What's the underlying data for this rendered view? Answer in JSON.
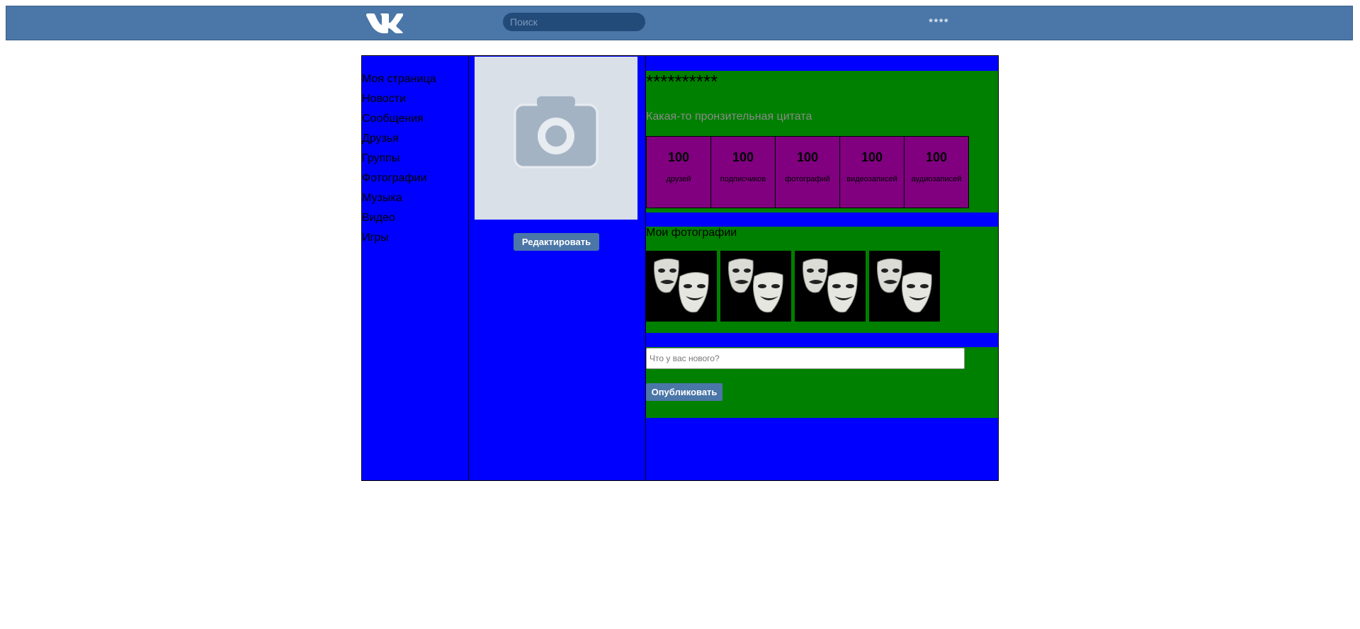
{
  "header": {
    "logo_icon": "vk-logo-icon",
    "search_placeholder": "Поиск",
    "user_name": "****"
  },
  "colors": {
    "header": "#4a76a8",
    "columns": "#0000ff",
    "sections": "#008000",
    "stats": "#800080",
    "buttons": "#4a76a8"
  },
  "sidebar": {
    "items": [
      {
        "label": "Моя страница"
      },
      {
        "label": "Новости"
      },
      {
        "label": "Сообщения"
      },
      {
        "label": "Друзья"
      },
      {
        "label": "Группы"
      },
      {
        "label": "Фотографии"
      },
      {
        "label": "Музыка"
      },
      {
        "label": "Видео"
      },
      {
        "label": "Игры"
      }
    ]
  },
  "profile": {
    "avatar_icon": "camera-placeholder-icon",
    "edit_label": "Редактировать",
    "name": "**********",
    "quote": "Какая-то пронзительная цитата",
    "stats": [
      {
        "value": "100",
        "label": "друзей"
      },
      {
        "value": "100",
        "label": "подписчиков"
      },
      {
        "value": "100",
        "label": "фотографий"
      },
      {
        "value": "100",
        "label": "видеозаписей"
      },
      {
        "value": "100",
        "label": "аудиозаписей"
      }
    ]
  },
  "photos": {
    "title": "Мои фотографии",
    "thumb_icon": "theatre-masks-icon"
  },
  "post": {
    "placeholder": "Что у вас нового?",
    "publish_label": "Опубликовать"
  }
}
